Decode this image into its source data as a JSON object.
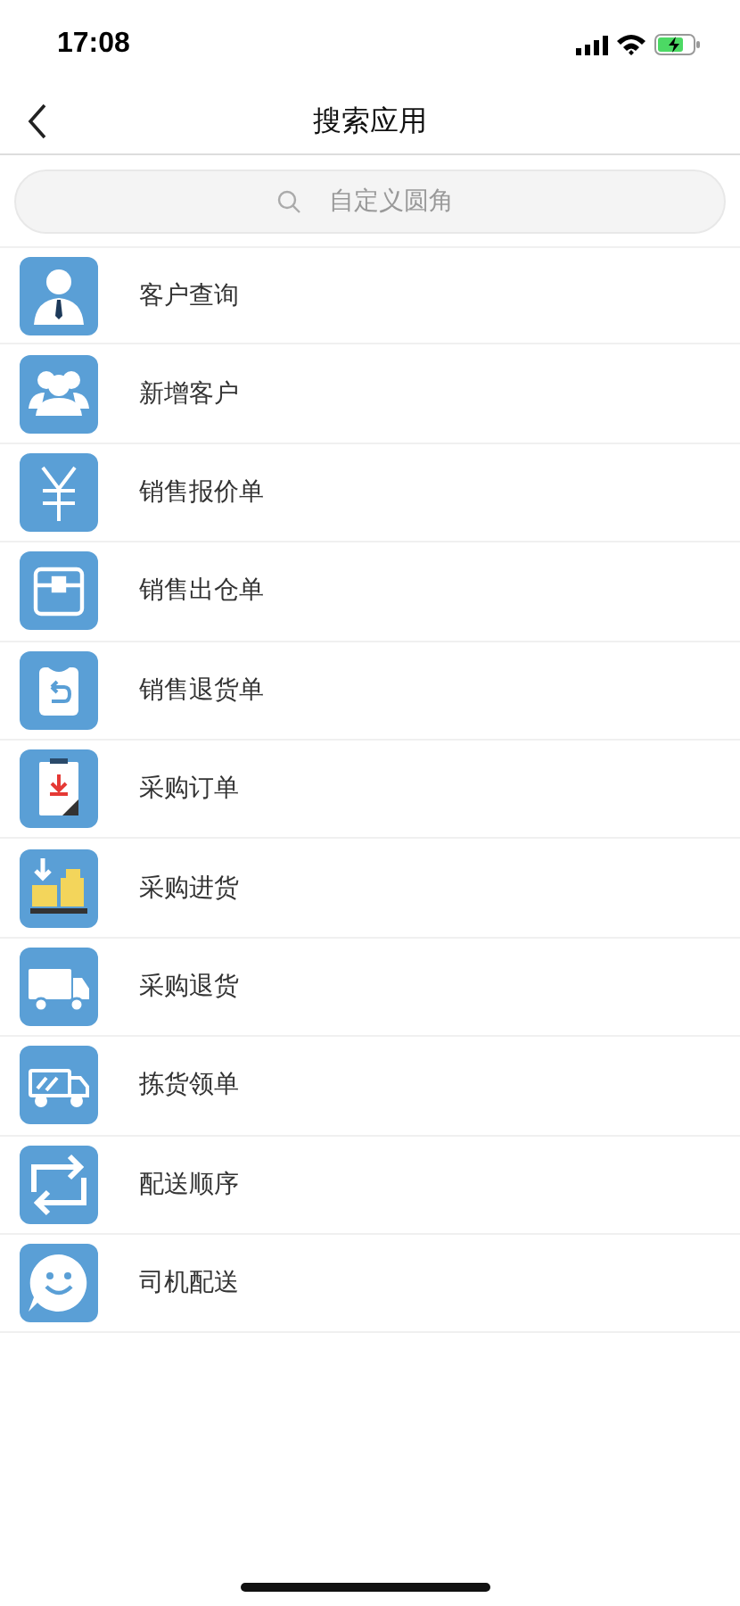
{
  "status_bar": {
    "time": "17:08"
  },
  "nav": {
    "title": "搜索应用"
  },
  "search": {
    "placeholder": "自定义圆角"
  },
  "items": [
    {
      "label": "客户查询",
      "kind": "person"
    },
    {
      "label": "新增客户",
      "kind": "group"
    },
    {
      "label": "销售报价单",
      "kind": "yen"
    },
    {
      "label": "销售出仓单",
      "kind": "box"
    },
    {
      "label": "销售退货单",
      "kind": "return"
    },
    {
      "label": "采购订单",
      "kind": "document"
    },
    {
      "label": "采购进货",
      "kind": "boxes"
    },
    {
      "label": "采购退货",
      "kind": "truck"
    },
    {
      "label": "拣货领单",
      "kind": "van"
    },
    {
      "label": "配送顺序",
      "kind": "swap"
    },
    {
      "label": "司机配送",
      "kind": "smile"
    }
  ]
}
